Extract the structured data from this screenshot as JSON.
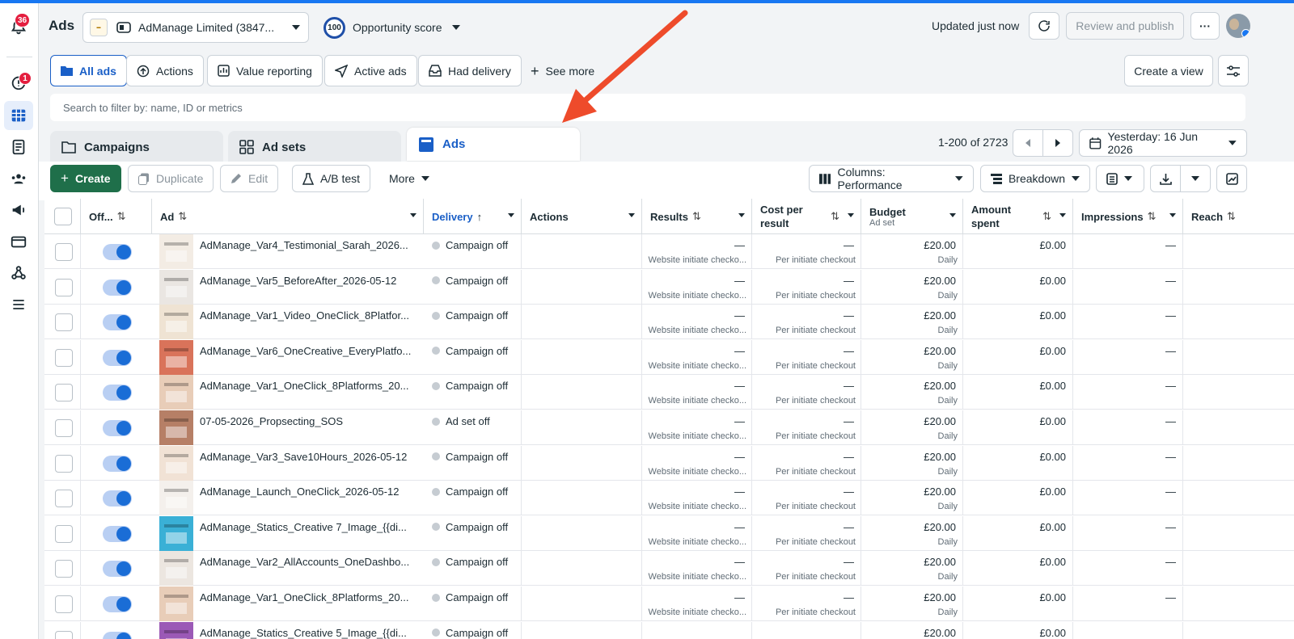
{
  "nav": {
    "notif_count": "36",
    "alerts_count": "1",
    "items": [
      "notifications-icon",
      "alerts-icon",
      "ads-manager-table-icon",
      "pages-icon",
      "audiences-icon",
      "campaign-icon",
      "billing-icon",
      "events-icon",
      "menu-icon"
    ]
  },
  "header": {
    "title": "Ads",
    "account_name": "AdManage Limited (3847...",
    "opportunity_score": "100",
    "opportunity_label": "Opportunity score",
    "updated": "Updated just now",
    "review_publish": "Review and publish",
    "more": "···"
  },
  "filters": {
    "chips": [
      "All ads",
      "Actions",
      "Value reporting",
      "Active ads",
      "Had delivery",
      "See more"
    ],
    "create_view": "Create a view",
    "search_placeholder": "Search to filter by: name, ID or metrics"
  },
  "tabs": {
    "campaigns": "Campaigns",
    "adsets": "Ad sets",
    "ads": "Ads",
    "pagination": "1-200 of 2723",
    "date": "Yesterday: 16 Jun 2026"
  },
  "toolbar": {
    "create": "Create",
    "duplicate": "Duplicate",
    "edit": "Edit",
    "ab_test": "A/B test",
    "more": "More",
    "columns": "Columns: Performance",
    "breakdown": "Breakdown"
  },
  "table": {
    "headers": {
      "offon": "Off...",
      "ad": "Ad",
      "delivery": "Delivery",
      "actions": "Actions",
      "results": "Results",
      "cost_per_result": "Cost per result",
      "budget": "Budget",
      "budget_sub": "Ad set",
      "amount_spent": "Amount spent",
      "impressions": "Impressions",
      "reach": "Reach"
    },
    "rows": [
      {
        "name": "AdManage_Var4_Testimonial_Sarah_2026...",
        "delivery": "Campaign off",
        "results": "—",
        "results_sub": "Website initiate checko...",
        "cpr": "—",
        "cpr_sub": "Per initiate checkout",
        "budget": "£20.00",
        "budget_sub": "Daily",
        "spent": "£0.00",
        "impr": "—",
        "thumb": "#f3ece4"
      },
      {
        "name": "AdManage_Var5_BeforeAfter_2026-05-12",
        "delivery": "Campaign off",
        "results": "—",
        "results_sub": "Website initiate checko...",
        "cpr": "—",
        "cpr_sub": "Per initiate checkout",
        "budget": "£20.00",
        "budget_sub": "Daily",
        "spent": "£0.00",
        "impr": "—",
        "thumb": "#eae6e2"
      },
      {
        "name": "AdManage_Var1_Video_OneClick_8Platfor...",
        "delivery": "Campaign off",
        "results": "—",
        "results_sub": "Website initiate checko...",
        "cpr": "—",
        "cpr_sub": "Per initiate checkout",
        "budget": "£20.00",
        "budget_sub": "Daily",
        "spent": "£0.00",
        "impr": "—",
        "thumb": "#efe3d3"
      },
      {
        "name": "AdManage_Var6_OneCreative_EveryPlatfo...",
        "delivery": "Campaign off",
        "results": "—",
        "results_sub": "Website initiate checko...",
        "cpr": "—",
        "cpr_sub": "Per initiate checkout",
        "budget": "£20.00",
        "budget_sub": "Daily",
        "spent": "£0.00",
        "impr": "—",
        "thumb": "#d9735a"
      },
      {
        "name": "AdManage_Var1_OneClick_8Platforms_20...",
        "delivery": "Campaign off",
        "results": "—",
        "results_sub": "Website initiate checko...",
        "cpr": "—",
        "cpr_sub": "Per initiate checkout",
        "budget": "£20.00",
        "budget_sub": "Daily",
        "spent": "£0.00",
        "impr": "—",
        "thumb": "#e8cdb8"
      },
      {
        "name": "07-05-2026_Propsecting_SOS",
        "delivery": "Ad set off",
        "results": "—",
        "results_sub": "Website initiate checko...",
        "cpr": "—",
        "cpr_sub": "Per initiate checkout",
        "budget": "£20.00",
        "budget_sub": "Daily",
        "spent": "£0.00",
        "impr": "—",
        "thumb": "#b67f66"
      },
      {
        "name": "AdManage_Var3_Save10Hours_2026-05-12",
        "delivery": "Campaign off",
        "results": "—",
        "results_sub": "Website initiate checko...",
        "cpr": "—",
        "cpr_sub": "Per initiate checkout",
        "budget": "£20.00",
        "budget_sub": "Daily",
        "spent": "£0.00",
        "impr": "—",
        "thumb": "#f1e2d5"
      },
      {
        "name": "AdManage_Launch_OneClick_2026-05-12",
        "delivery": "Campaign off",
        "results": "—",
        "results_sub": "Website initiate checko...",
        "cpr": "—",
        "cpr_sub": "Per initiate checkout",
        "budget": "£20.00",
        "budget_sub": "Daily",
        "spent": "£0.00",
        "impr": "—",
        "thumb": "#f4f0ec"
      },
      {
        "name": "AdManage_Statics_Creative 7_Image_{{di...",
        "delivery": "Campaign off",
        "results": "—",
        "results_sub": "Website initiate checko...",
        "cpr": "—",
        "cpr_sub": "Per initiate checkout",
        "budget": "£20.00",
        "budget_sub": "Daily",
        "spent": "£0.00",
        "impr": "—",
        "thumb": "#3ab0d6"
      },
      {
        "name": "AdManage_Var2_AllAccounts_OneDashbo...",
        "delivery": "Campaign off",
        "results": "—",
        "results_sub": "Website initiate checko...",
        "cpr": "—",
        "cpr_sub": "Per initiate checkout",
        "budget": "£20.00",
        "budget_sub": "Daily",
        "spent": "£0.00",
        "impr": "—",
        "thumb": "#ece6e0"
      },
      {
        "name": "AdManage_Var1_OneClick_8Platforms_20...",
        "delivery": "Campaign off",
        "results": "—",
        "results_sub": "Website initiate checko...",
        "cpr": "—",
        "cpr_sub": "Per initiate checkout",
        "budget": "£20.00",
        "budget_sub": "Daily",
        "spent": "£0.00",
        "impr": "—",
        "thumb": "#e8cdb8"
      },
      {
        "name": "AdManage_Statics_Creative 5_Image_{{di...",
        "delivery": "Campaign off",
        "results": "",
        "results_sub": "",
        "cpr": "",
        "cpr_sub": "",
        "budget": "£20.00",
        "budget_sub": "",
        "spent": "£0.00",
        "impr": "",
        "thumb": "#9b59b6"
      }
    ]
  },
  "colors": {
    "accent": "#1877f2",
    "create_green": "#1f6f4a",
    "annotation_arrow": "#ee4b2b"
  }
}
